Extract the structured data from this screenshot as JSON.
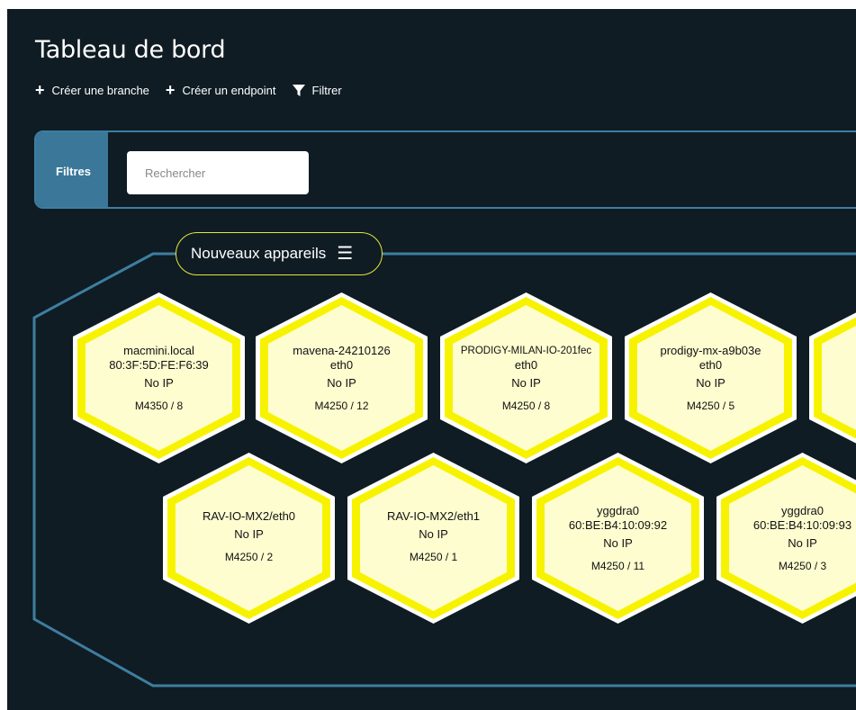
{
  "page": {
    "title": "Tableau de bord"
  },
  "toolbar": {
    "create_branch": "Créer une branche",
    "create_endpoint": "Créer un endpoint",
    "filter": "Filtrer"
  },
  "filters": {
    "tab_label": "Filtres",
    "search_placeholder": "Rechercher",
    "search_value": ""
  },
  "group": {
    "label": "Nouveaux appareils",
    "devices": [
      {
        "name": "macmini.local",
        "interface": "80:3F:5D:FE:F6:39",
        "ip": "No IP",
        "model": "M4350 / 8"
      },
      {
        "name": "mavena-24210126",
        "interface": "eth0",
        "ip": "No IP",
        "model": "M4250 / 12"
      },
      {
        "name": "PRODIGY-MILAN-IO-201fec",
        "interface": "eth0",
        "ip": "No IP",
        "model": "M4250 / 8"
      },
      {
        "name": "prodigy-mx-a9b03e",
        "interface": "eth0",
        "ip": "No IP",
        "model": "M4250 / 5"
      },
      {
        "name": "PRODI",
        "interface": "",
        "ip": "",
        "model": ""
      },
      {
        "name": "RAV-IO-MX2/eth0",
        "interface": "",
        "ip": "No IP",
        "model": "M4250 / 2"
      },
      {
        "name": "RAV-IO-MX2/eth1",
        "interface": "",
        "ip": "No IP",
        "model": "M4250 / 1"
      },
      {
        "name": "yggdra0",
        "interface": "60:BE:B4:10:09:92",
        "ip": "No IP",
        "model": "M4250 / 11"
      },
      {
        "name": "yggdra0",
        "interface": "60:BE:B4:10:09:93",
        "ip": "No IP",
        "model": "M4250 / 3"
      }
    ]
  },
  "colors": {
    "background": "#0f1c24",
    "accent_blue": "#3e7ea0",
    "hex_fill": "#fefdd0",
    "hex_border": "#f7f300",
    "group_border": "#e6e63a"
  }
}
